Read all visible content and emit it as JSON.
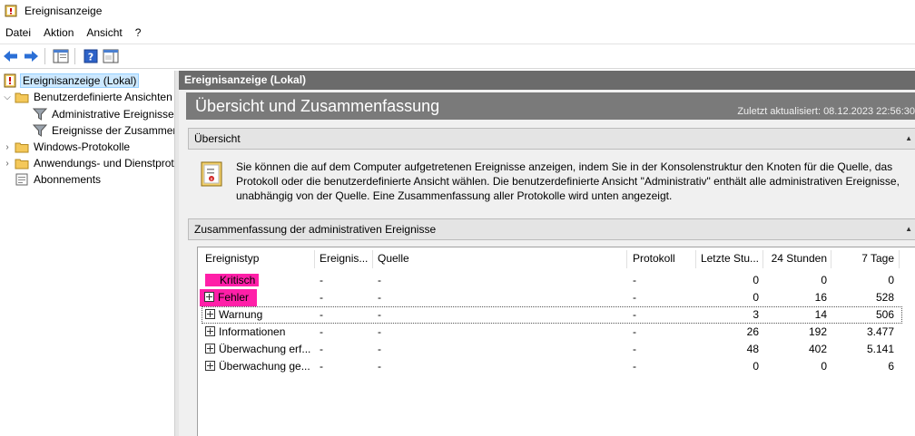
{
  "window": {
    "title": "Ereignisanzeige",
    "icon": "event-viewer-icon"
  },
  "menu": [
    "Datei",
    "Aktion",
    "Ansicht",
    "?"
  ],
  "toolbar": {
    "icons": [
      "back-arrow-icon",
      "forward-arrow-icon",
      "show-hide-console-tree-icon",
      "help-icon",
      "show-hide-action-pane-icon"
    ],
    "colors": {
      "arrow": "#2b6fd6"
    }
  },
  "tree": {
    "root": "Ereignisanzeige (Lokal)",
    "custom_views": "Benutzerdefinierte Ansichten",
    "admin_events": "Administrative Ereignisse",
    "summary_events": "Ereignisse der Zusammenfassung",
    "windows_logs": "Windows-Protokolle",
    "app_service_logs": "Anwendungs- und Dienstprotokolle",
    "subscriptions": "Abonnements"
  },
  "main": {
    "header": "Ereignisanzeige (Lokal)",
    "banner_title": "Übersicht und Zusammenfassung",
    "updated": "Zuletzt aktualisiert: 08.12.2023 22:56:30",
    "overview_title": "Übersicht",
    "overview_text": "Sie können die auf dem Computer aufgetretenen Ereignisse anzeigen, indem Sie in der Konsolenstruktur den Knoten für die Quelle, das Protokoll oder die benutzerdefinierte Ansicht wählen. Die benutzerdefinierte Ansicht \"Administrativ\" enthält alle administrativen Ereignisse, unabhängig von der Quelle. Eine Zusammenfassung aller Protokolle wird unten angezeigt.",
    "summary_title": "Zusammenfassung der administrativen Ereignisse"
  },
  "table": {
    "columns": [
      "Ereignistyp",
      "Ereignis...",
      "Quelle",
      "Protokoll",
      "Letzte Stu...",
      "24 Stunden",
      "7 Tage"
    ],
    "rows": [
      {
        "type": "Kritisch",
        "id": "-",
        "source": "-",
        "log": "-",
        "last_hour": "0",
        "h24": "0",
        "d7": "0"
      },
      {
        "type": "Fehler",
        "id": "-",
        "source": "-",
        "log": "-",
        "last_hour": "0",
        "h24": "16",
        "d7": "528"
      },
      {
        "type": "Warnung",
        "id": "-",
        "source": "-",
        "log": "-",
        "last_hour": "3",
        "h24": "14",
        "d7": "506"
      },
      {
        "type": "Informationen",
        "id": "-",
        "source": "-",
        "log": "-",
        "last_hour": "26",
        "h24": "192",
        "d7": "3.477"
      },
      {
        "type": "Überwachung erf...",
        "id": "-",
        "source": "-",
        "log": "-",
        "last_hour": "48",
        "h24": "402",
        "d7": "5.141"
      },
      {
        "type": "Überwachung ge...",
        "id": "-",
        "source": "-",
        "log": "-",
        "last_hour": "0",
        "h24": "0",
        "d7": "6"
      }
    ],
    "highlight_color": "#ff1fa8"
  }
}
